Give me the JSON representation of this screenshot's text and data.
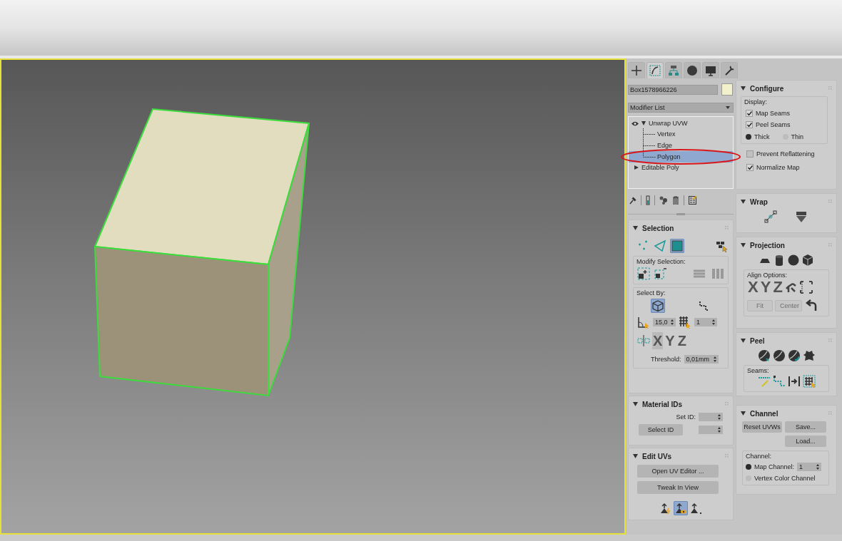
{
  "command_tabs": [
    {
      "selected": false
    },
    {
      "selected": true
    },
    {
      "selected": false
    },
    {
      "selected": false
    },
    {
      "selected": false
    },
    {
      "selected": false
    }
  ],
  "object_name": "Box1578966226",
  "modifier_list": "Modifier List",
  "modifier_stack": [
    {
      "label": "Unwrap UVW",
      "expanded": true,
      "children": [
        {
          "label": "Vertex",
          "selected": false
        },
        {
          "label": "Edge",
          "selected": false
        },
        {
          "label": "Polygon",
          "selected": true
        }
      ]
    },
    {
      "label": "Editable Poly",
      "expanded": false
    }
  ],
  "configure": {
    "title": "Configure",
    "display_label": "Display:",
    "display_options": [
      {
        "label": "Map Seams",
        "checked": true
      },
      {
        "label": "Peel Seams",
        "checked": true
      }
    ],
    "seam_width": [
      {
        "label": "Thick",
        "selected": true
      },
      {
        "label": "Thin",
        "selected": false
      }
    ],
    "options": [
      {
        "label": "Prevent Reflattening",
        "checked": false
      },
      {
        "label": "Normalize Map",
        "checked": true
      }
    ]
  },
  "wrap": {
    "title": "Wrap"
  },
  "projection": {
    "title": "Projection",
    "align_label": "Align Options:",
    "axes": [
      "X",
      "Y",
      "Z"
    ],
    "buttons": [
      {
        "label": "Fit",
        "disabled": true
      },
      {
        "label": "Center",
        "disabled": true
      }
    ]
  },
  "peel": {
    "title": "Peel",
    "seams_label": "Seams:"
  },
  "channel": {
    "title": "Channel",
    "buttons": [
      "Reset UVWs",
      "Save...",
      "Load..."
    ],
    "group_label": "Channel:",
    "map_channel": {
      "label": "Map Channel:",
      "selected": true,
      "value": "1"
    },
    "vertex_color": {
      "label": "Vertex Color Channel",
      "selected": false
    }
  },
  "selection": {
    "title": "Selection",
    "modes": [
      {
        "selected": false
      },
      {
        "selected": false
      },
      {
        "selected": true
      }
    ],
    "modify_label": "Modify Selection:",
    "select_by_label": "Select By:",
    "select_by": [
      {
        "selected": true
      },
      {
        "selected": false
      }
    ],
    "angle_value": "15,0",
    "smooth_value": "1",
    "axes": [
      {
        "label": "X",
        "selected": true
      },
      {
        "label": "Y",
        "selected": false
      },
      {
        "label": "Z",
        "selected": false
      }
    ],
    "threshold_label": "Threshold:",
    "threshold_value": "0,01mm"
  },
  "material_ids": {
    "title": "Material IDs",
    "set_id_label": "Set ID:",
    "select_id_button": "Select ID"
  },
  "edit_uvs": {
    "title": "Edit UVs",
    "buttons": [
      "Open UV Editor ...",
      "Tweak In View"
    ],
    "tools": [
      {
        "selected": false
      },
      {
        "selected": true
      },
      {
        "selected": false
      }
    ]
  }
}
